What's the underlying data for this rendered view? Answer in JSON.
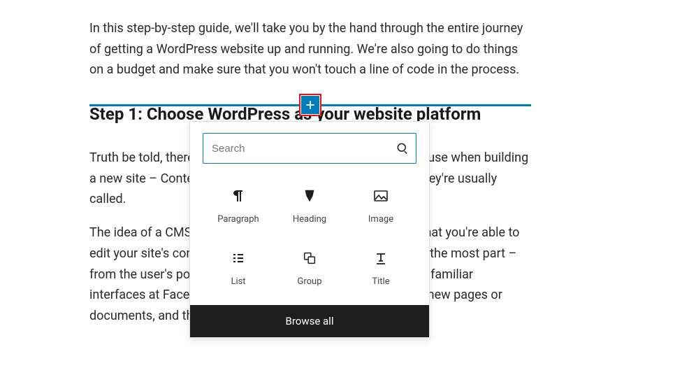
{
  "content": {
    "para1": "In this step-by-step guide, we'll take you by the hand through the entire journey of getting a WordPress website up and running. We're also going to do things on a budget and make sure that you won't touch a line of code in the process.",
    "heading": "Step 1: Choose WordPress as your website platform",
    "para2": "Truth be told, there are many website platforms that you can use when building a new site – Content Management Systems (CMS) is what they're usually called.",
    "para3": "The idea of a CMS is to give you some easy-to-use tools so that you're able to edit your site's content without any knowledge of coding. For the most part – from the user's point of view – those CMS look much like the familiar interfaces at Facebook or Google Docs. You basically create new pages or documents, and then have them published on the web."
  },
  "inserter": {
    "search_placeholder": "Search",
    "blocks": [
      {
        "name": "paragraph",
        "label": "Paragraph"
      },
      {
        "name": "heading",
        "label": "Heading"
      },
      {
        "name": "image",
        "label": "Image"
      },
      {
        "name": "list",
        "label": "List"
      },
      {
        "name": "group",
        "label": "Group"
      },
      {
        "name": "title",
        "label": "Title"
      }
    ],
    "browse_all_label": "Browse all"
  }
}
